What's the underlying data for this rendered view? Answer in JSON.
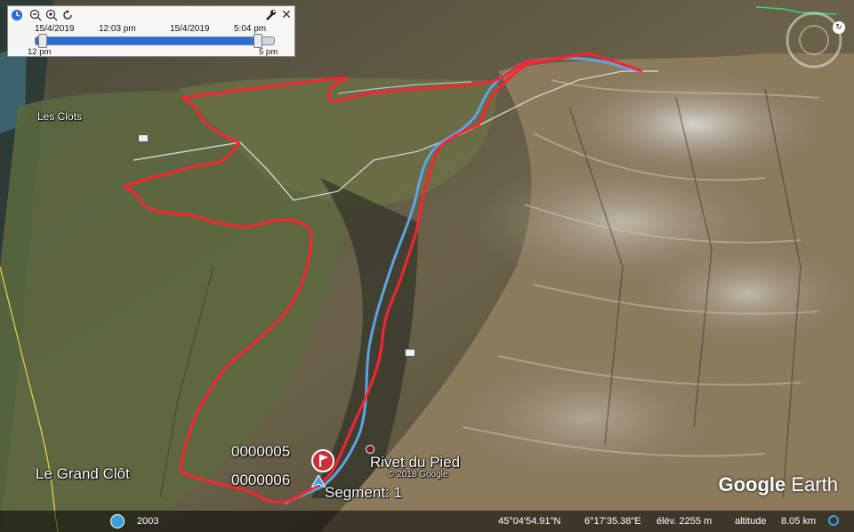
{
  "time_slider": {
    "start_date": "15/4/2019",
    "start_time": "12:03 pm",
    "end_date": "15/4/2019",
    "end_time": "5:04 pm",
    "range_start": "12 pm",
    "range_end": "5 pm",
    "fill_fraction": 0.92
  },
  "place_labels": {
    "les_clots": "Les Clots",
    "le_grand_clot": "Le Grand Clôt",
    "rivet_du_pied": "Rivet du Pied"
  },
  "markers": {
    "flag_label_1": "0000005",
    "flag_label_2": "0000006",
    "segment": "Segment: 1"
  },
  "copyright": "© 2018 Google",
  "status_bar": {
    "year": "2003",
    "lat": "45°04'54.91\"N",
    "lon": "6°17'35.38\"E",
    "elev": "élév. 2255 m",
    "altitude_label": "altitude",
    "altitude_value": "8.05 km"
  },
  "logo": {
    "brand": "Google",
    "product": "Earth"
  },
  "colors": {
    "track_red": "#ff2230",
    "track_blue": "#5fa3e6",
    "road": "#c8c8c8"
  }
}
